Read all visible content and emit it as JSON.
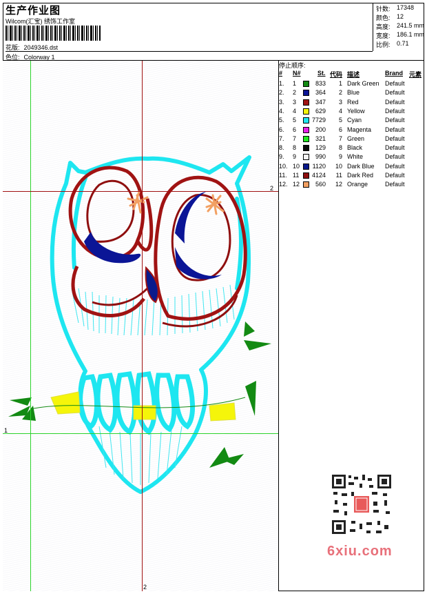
{
  "header": {
    "title": "生产作业图",
    "company": "Wilcom(汇宝) 绣饰工作室",
    "design_label": "花版:",
    "design_value": "2049346.dst",
    "colorway_label": "色位:",
    "colorway_value": "Colorway 1"
  },
  "stats": [
    {
      "label": "针数:",
      "value": "17348"
    },
    {
      "label": "颜色:",
      "value": "12"
    },
    {
      "label": "高度:",
      "value": "241.5 mm"
    },
    {
      "label": "宽度:",
      "value": "186.1 mm"
    },
    {
      "label": "比例:",
      "value": "0.71"
    }
  ],
  "crosshair_labels": {
    "top_right": "2",
    "left": "1",
    "bottom": "2"
  },
  "stop_sequence": {
    "title": "停止顺序:",
    "columns": [
      "#",
      "N#",
      "St.",
      "代码",
      "描述",
      "Brand",
      "元素"
    ],
    "rows": [
      {
        "idx": "1.",
        "n": "1",
        "st": "833",
        "code": "1",
        "desc": "Dark Green",
        "brand": "Default",
        "color": "#138a13"
      },
      {
        "idx": "2.",
        "n": "2",
        "st": "364",
        "code": "2",
        "desc": "Blue",
        "brand": "Default",
        "color": "#0b1596"
      },
      {
        "idx": "3.",
        "n": "3",
        "st": "347",
        "code": "3",
        "desc": "Red",
        "brand": "Default",
        "color": "#a01313"
      },
      {
        "idx": "4.",
        "n": "4",
        "st": "629",
        "code": "4",
        "desc": "Yellow",
        "brand": "Default",
        "color": "#f5f50a"
      },
      {
        "idx": "5.",
        "n": "5",
        "st": "7729",
        "code": "5",
        "desc": "Cyan",
        "brand": "Default",
        "color": "#1ee6f0"
      },
      {
        "idx": "6.",
        "n": "6",
        "st": "200",
        "code": "6",
        "desc": "Magenta",
        "brand": "Default",
        "color": "#e61ee6"
      },
      {
        "idx": "7.",
        "n": "7",
        "st": "321",
        "code": "7",
        "desc": "Green",
        "brand": "Default",
        "color": "#1ee61e"
      },
      {
        "idx": "8.",
        "n": "8",
        "st": "129",
        "code": "8",
        "desc": "Black",
        "brand": "Default",
        "color": "#0a0a0a"
      },
      {
        "idx": "9.",
        "n": "9",
        "st": "990",
        "code": "9",
        "desc": "White",
        "brand": "Default",
        "color": "#f4f4f4"
      },
      {
        "idx": "10.",
        "n": "10",
        "st": "1120",
        "code": "10",
        "desc": "Dark Blue",
        "brand": "Default",
        "color": "#0a1a8c"
      },
      {
        "idx": "11.",
        "n": "11",
        "st": "4124",
        "code": "11",
        "desc": "Dark Red",
        "brand": "Default",
        "color": "#8f0f0f"
      },
      {
        "idx": "12.",
        "n": "12",
        "st": "560",
        "code": "12",
        "desc": "Orange",
        "brand": "Default",
        "color": "#f2a062"
      }
    ]
  },
  "watermark": "6xiu.com",
  "icons": {
    "barcode": "barcode-icon",
    "qr": "qr-code-icon",
    "owl": "owl-embroidery-icon"
  }
}
